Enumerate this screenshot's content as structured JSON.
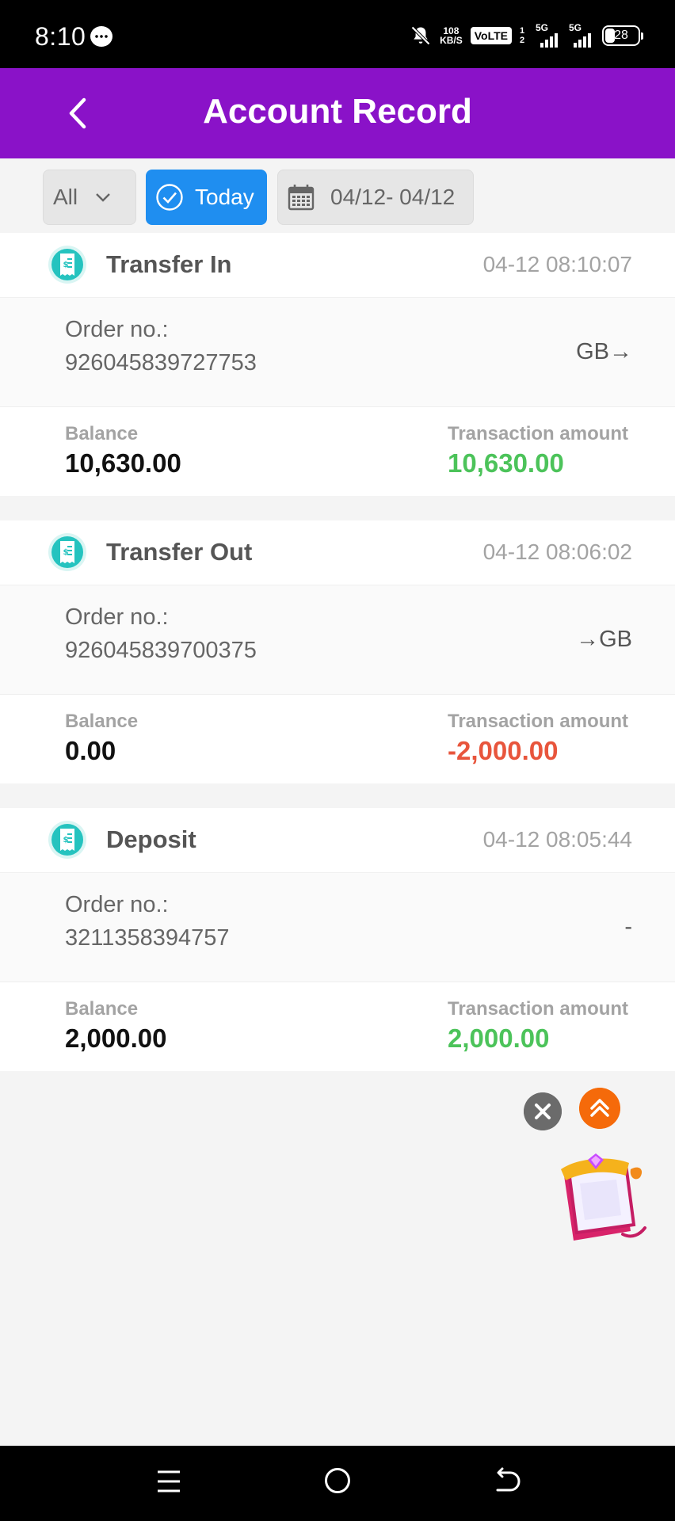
{
  "status_bar": {
    "time": "8:10",
    "net_speed_value": "108",
    "net_speed_unit": "KB/S",
    "volte": "VoLTE",
    "sim_slots": "1 2",
    "sig1": "5G",
    "sig2": "5G",
    "battery": "28"
  },
  "header": {
    "title": "Account Record"
  },
  "filters": {
    "type_value": "All",
    "today_label": "Today",
    "date_range": "04/12- 04/12",
    "active_color": "#1f8ef0"
  },
  "labels": {
    "order": "Order no.:",
    "balance": "Balance",
    "amount": "Transaction amount"
  },
  "records": [
    {
      "type": "Transfer In",
      "time": "04-12 08:10:07",
      "order_no": "926045839727753",
      "direction": "GB→",
      "balance": "10,630.00",
      "amount": "10,630.00",
      "amount_color": "#4cc35a"
    },
    {
      "type": "Transfer Out",
      "time": "04-12 08:06:02",
      "order_no": "926045839700375",
      "direction": "→GB",
      "balance": "0.00",
      "amount": "-2,000.00",
      "amount_color": "#e8553c"
    },
    {
      "type": "Deposit",
      "time": "04-12 08:05:44",
      "order_no": "3211358394757",
      "direction": "-",
      "balance": "2,000.00",
      "amount": "2,000.00",
      "amount_color": "#4cc35a"
    }
  ],
  "theme": {
    "header_color": "#8a12c8"
  }
}
